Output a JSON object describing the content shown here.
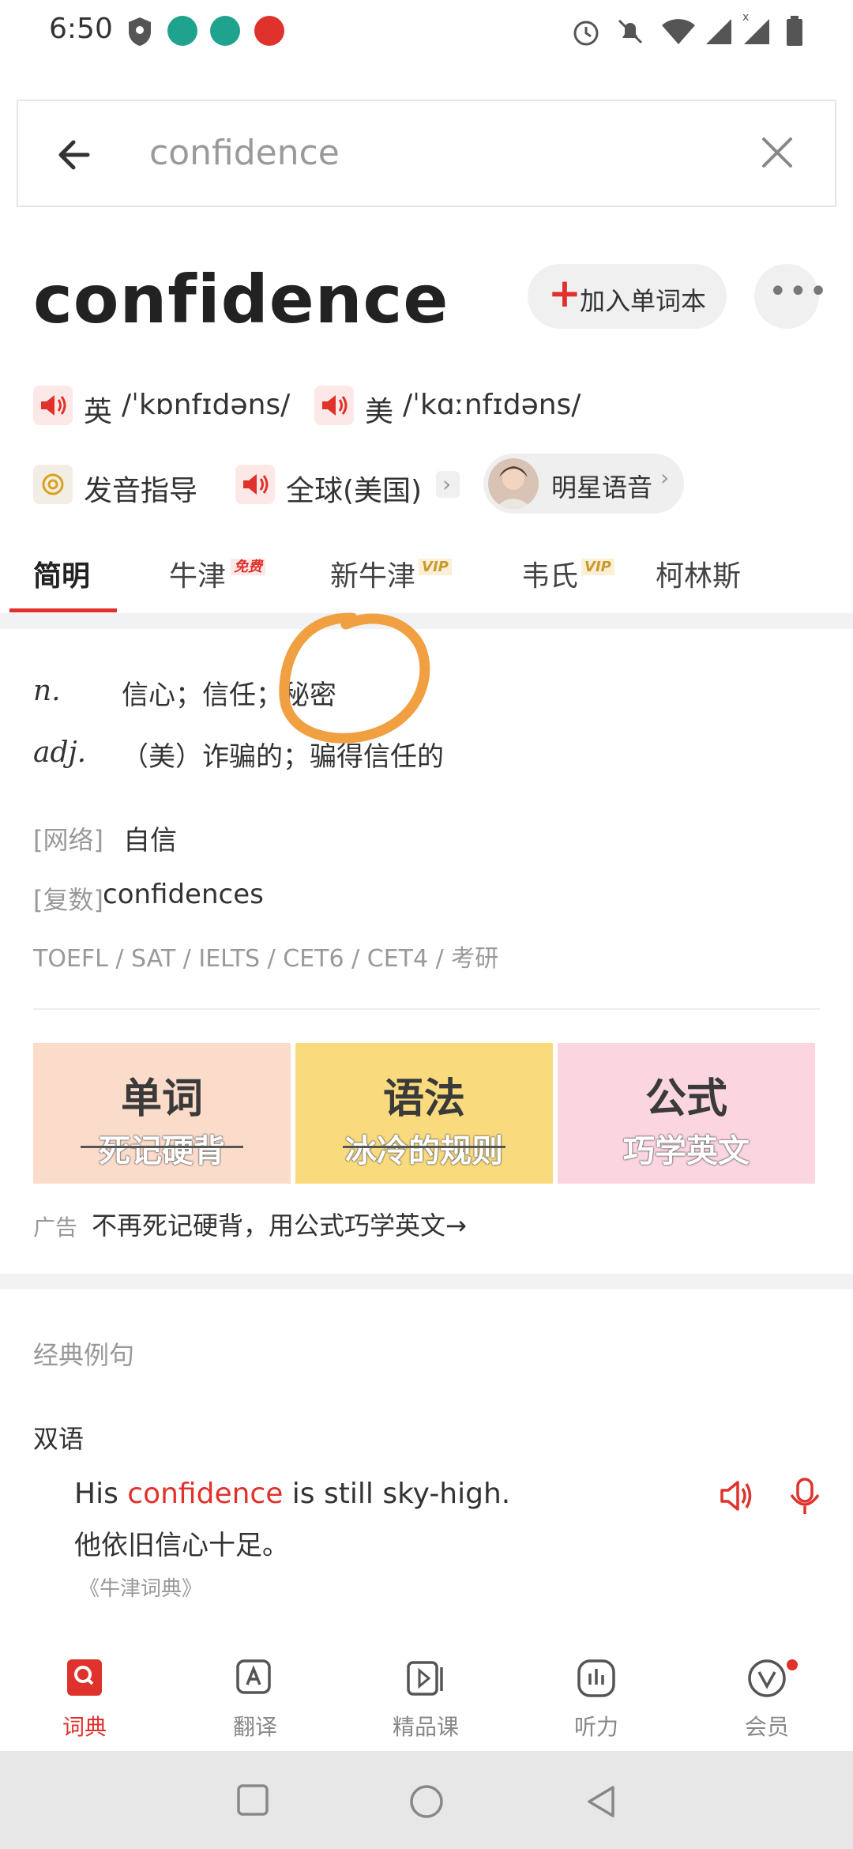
{
  "status_bar": {
    "time": "6:50",
    "icons": [
      "shield-icon",
      "android-icon",
      "android-icon",
      "search-app-icon",
      "alarm-icon",
      "bell-off-icon",
      "wifi-icon",
      "signal-icon",
      "signal-x-icon",
      "battery-icon"
    ]
  },
  "search": {
    "query": "confidence",
    "clear_icon": "close-icon"
  },
  "word": {
    "title": "confidence",
    "add_label": "加入单词本",
    "uk_label": "英",
    "uk_ipa": "/ˈkɒnfɪdəns/",
    "us_label": "美",
    "us_ipa": "/ˈkɑːnfɪdəns/",
    "guide_label": "发音指导",
    "global_label": "全球(美国)",
    "star_label": "明星语音"
  },
  "tabs": [
    {
      "label": "简明",
      "badge": ""
    },
    {
      "label": "牛津",
      "badge": "免费"
    },
    {
      "label": "新牛津",
      "badge": "VIP"
    },
    {
      "label": "韦氏",
      "badge": "VIP"
    },
    {
      "label": "柯林斯",
      "badge": ""
    }
  ],
  "definitions": [
    {
      "pos": "n.",
      "text": "信心；信任；秘密"
    },
    {
      "pos": "adj.",
      "text": "（美）诈骗的；骗得信任的"
    }
  ],
  "web": {
    "tag": "[网络]",
    "value": "自信"
  },
  "plural": {
    "tag": "[复数]",
    "value": "confidences"
  },
  "exams": "TOEFL / SAT / IELTS / CET6 / CET4 / 考研",
  "ad": {
    "cards": [
      {
        "big": "单词",
        "small": "死记硬背",
        "color": "#fbdccb"
      },
      {
        "big": "语法",
        "small": "冰冷的规则",
        "color": "#f9db7e"
      },
      {
        "big": "公式",
        "small": "巧学英文",
        "color": "#fbd5e0"
      }
    ],
    "tag": "广告",
    "text": "不再死记硬背，用公式巧学英文→"
  },
  "examples": {
    "title": "经典例句",
    "bilingual": "双语",
    "en_before": "His ",
    "en_highlight": "confidence",
    "en_after": " is still sky-high.",
    "cn": "他依旧信心十足。",
    "source": "《牛津词典》"
  },
  "bottom_nav": [
    {
      "label": "词典",
      "icon": "dictionary-icon",
      "active": true
    },
    {
      "label": "翻译",
      "icon": "translate-icon",
      "active": false
    },
    {
      "label": "精品课",
      "icon": "course-icon",
      "active": false
    },
    {
      "label": "听力",
      "icon": "listening-icon",
      "active": false
    },
    {
      "label": "会员",
      "icon": "vip-icon",
      "active": false
    }
  ],
  "colors": {
    "accent": "#e0322c",
    "annotation": "#f0a040"
  }
}
